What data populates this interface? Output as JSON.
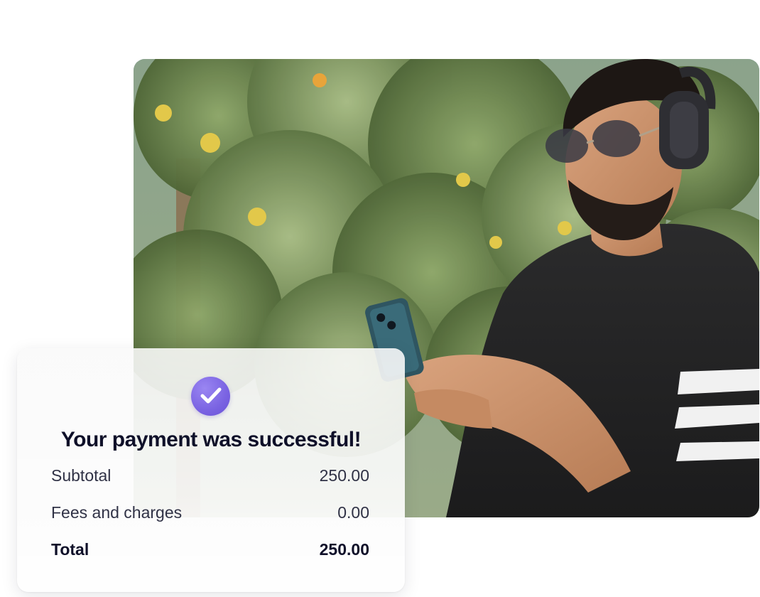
{
  "colors": {
    "accent": "#7a63e2",
    "title_text": "#0f1029",
    "body_text": "#303246",
    "card_bg": "#f7f7f7"
  },
  "photo": {
    "icon": "person-with-phone-photo"
  },
  "payment_card": {
    "status_icon": "check-circle-icon",
    "title": "Your payment was successful!",
    "rows": [
      {
        "label": "Subtotal",
        "value": "250.00"
      },
      {
        "label": "Fees and charges",
        "value": "0.00"
      },
      {
        "label": "Total",
        "value": "250.00"
      }
    ]
  }
}
